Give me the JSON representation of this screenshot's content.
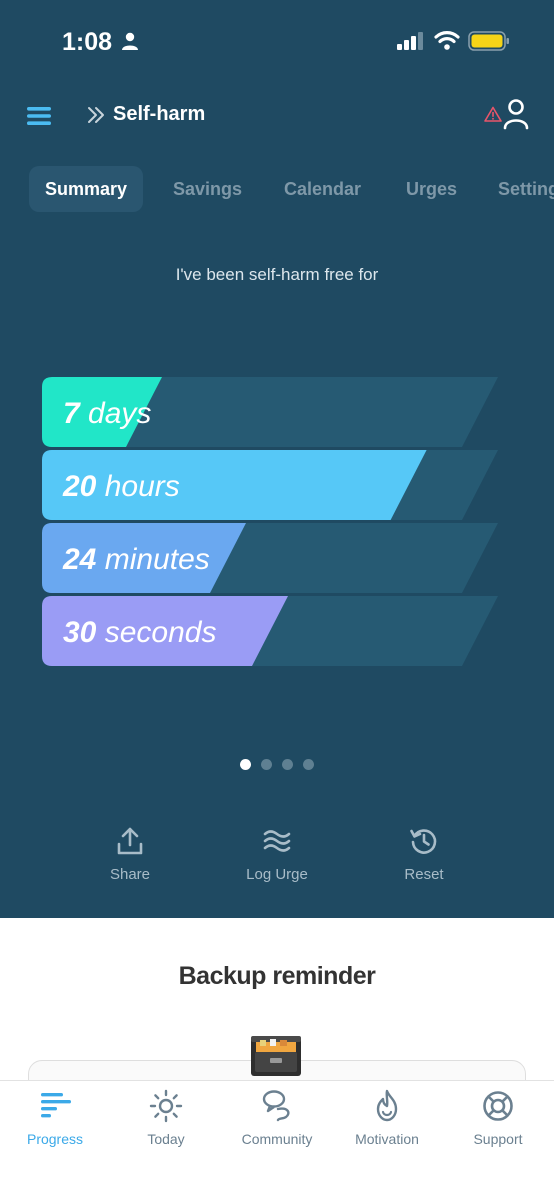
{
  "status_bar": {
    "time": "1:08"
  },
  "header": {
    "title": "Self-harm"
  },
  "tabs": [
    {
      "label": "Summary",
      "active": true
    },
    {
      "label": "Savings",
      "active": false
    },
    {
      "label": "Calendar",
      "active": false
    },
    {
      "label": "Urges",
      "active": false
    },
    {
      "label": "Settings",
      "active": false
    }
  ],
  "summary": {
    "label": "I've been self-harm free for",
    "bars": [
      {
        "value": "7",
        "unit": "days",
        "fill": 0.2,
        "color": "#21e6c8"
      },
      {
        "value": "20",
        "unit": "hours",
        "fill": 0.83,
        "color": "#56c8f7"
      },
      {
        "value": "24",
        "unit": "minutes",
        "fill": 0.4,
        "color": "#6aa8f0"
      },
      {
        "value": "30",
        "unit": "seconds",
        "fill": 0.5,
        "color": "#9a9cf5"
      }
    ],
    "page_dots": {
      "count": 4,
      "active": 0
    }
  },
  "actions": [
    {
      "label": "Share",
      "icon": "share-icon"
    },
    {
      "label": "Log Urge",
      "icon": "waves-icon"
    },
    {
      "label": "Reset",
      "icon": "history-icon"
    }
  ],
  "backup": {
    "title": "Backup reminder",
    "icon": "file-cabinet-icon"
  },
  "bottom_nav": [
    {
      "label": "Progress",
      "icon": "progress-icon",
      "active": true
    },
    {
      "label": "Today",
      "icon": "sun-icon",
      "active": false
    },
    {
      "label": "Community",
      "icon": "community-icon",
      "active": false
    },
    {
      "label": "Motivation",
      "icon": "flame-icon",
      "active": false
    },
    {
      "label": "Support",
      "icon": "lifebuoy-icon",
      "active": false
    }
  ],
  "colors": {
    "background": "#1f4a62",
    "track": "#265a73",
    "accent": "#3ba9e8",
    "warning": "#e8556a"
  }
}
